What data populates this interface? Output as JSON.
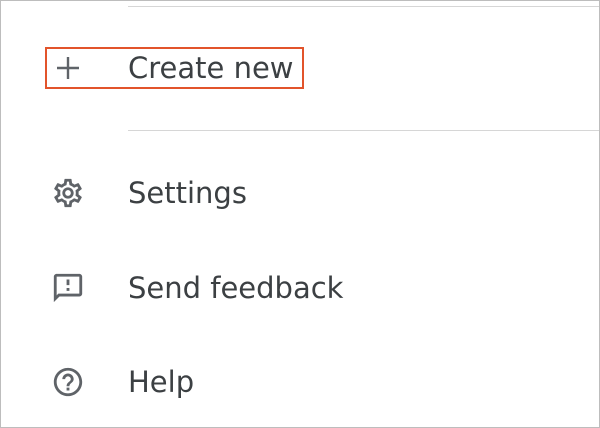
{
  "menu": {
    "items": [
      {
        "id": "create",
        "label": "Create new",
        "icon": "plus-icon",
        "highlighted": true
      },
      {
        "id": "settings",
        "label": "Settings",
        "icon": "gear-icon"
      },
      {
        "id": "feedback",
        "label": "Send feedback",
        "icon": "feedback-icon"
      },
      {
        "id": "help",
        "label": "Help",
        "icon": "help-circle-icon"
      }
    ]
  },
  "colors": {
    "text": "#3c4043",
    "icon": "#5f6368",
    "divider": "#d6d6d6",
    "highlight": "#e2542b"
  }
}
